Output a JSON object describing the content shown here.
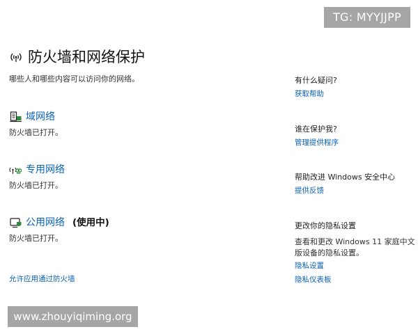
{
  "watermark_top": "TG: MYYJJPP",
  "watermark_bottom": "www.zhouyiqiming.org",
  "header": {
    "icon": "wireless-antenna-icon",
    "title": "防火墙和网络保护",
    "subtitle": "哪些人和哪些内容可以访问你的网络。"
  },
  "networks": [
    {
      "icon": "domain-network-icon",
      "label": "域网络",
      "status": "防火墙已打开。",
      "in_use": ""
    },
    {
      "icon": "private-network-icon",
      "label": "专用网络",
      "status": "防火墙已打开。",
      "in_use": ""
    },
    {
      "icon": "public-network-icon",
      "label": "公用网络",
      "status": "防火墙已打开。",
      "in_use": "(使用中)"
    }
  ],
  "allow_app_link": "允许应用通过防火墙",
  "side": {
    "questions": {
      "heading": "有什么疑问?",
      "link": "获取帮助"
    },
    "protector": {
      "heading": "谁在保护我?",
      "link": "管理提供程序"
    },
    "improve": {
      "heading": "帮助改进 Windows 安全中心",
      "link": "提供反馈"
    },
    "privacy": {
      "heading": "更改你的隐私设置",
      "text": "查看和更改 Windows 11 家庭中文版设备的隐私设置。",
      "link1": "隐私设置",
      "link2": "隐私仪表板"
    }
  },
  "colors": {
    "link": "#0b63b6",
    "watermark_bg": "#a6a6a6",
    "icon_green": "#2e8b3a"
  }
}
